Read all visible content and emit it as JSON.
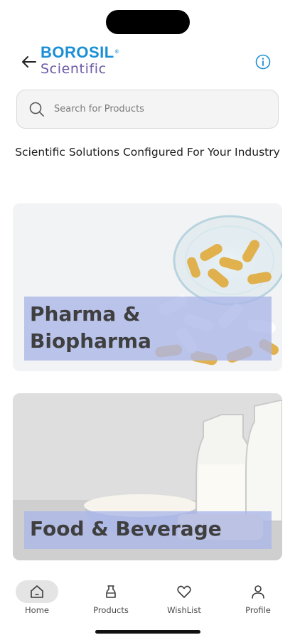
{
  "header": {
    "logo_primary": "BOROSIL",
    "logo_reg": "®",
    "logo_secondary": "Scientific",
    "back_icon": "arrow-left-icon",
    "info_icon": "info-circle-icon"
  },
  "search": {
    "placeholder": "Search for Products",
    "value": "",
    "icon": "search-icon"
  },
  "tagline": "Scientific Solutions Configured For Your Industry",
  "categories": [
    {
      "label": "Pharma & Biopharma",
      "image": "capsules-in-glass-jar"
    },
    {
      "label": "Food & Beverage",
      "image": "milk-bottles-and-cheese"
    }
  ],
  "tabbar": {
    "items": [
      {
        "label": "Home",
        "icon": "home-icon",
        "active": true
      },
      {
        "label": "Products",
        "icon": "flask-icon",
        "active": false
      },
      {
        "label": "WishList",
        "icon": "heart-icon",
        "active": false
      },
      {
        "label": "Profile",
        "icon": "user-icon",
        "active": false
      }
    ]
  },
  "colors": {
    "brand_blue": "#1a8fd6",
    "brand_purple": "#6b5ba8",
    "label_overlay": "#aab6e8",
    "active_tab_bg": "#e4e4e4"
  }
}
